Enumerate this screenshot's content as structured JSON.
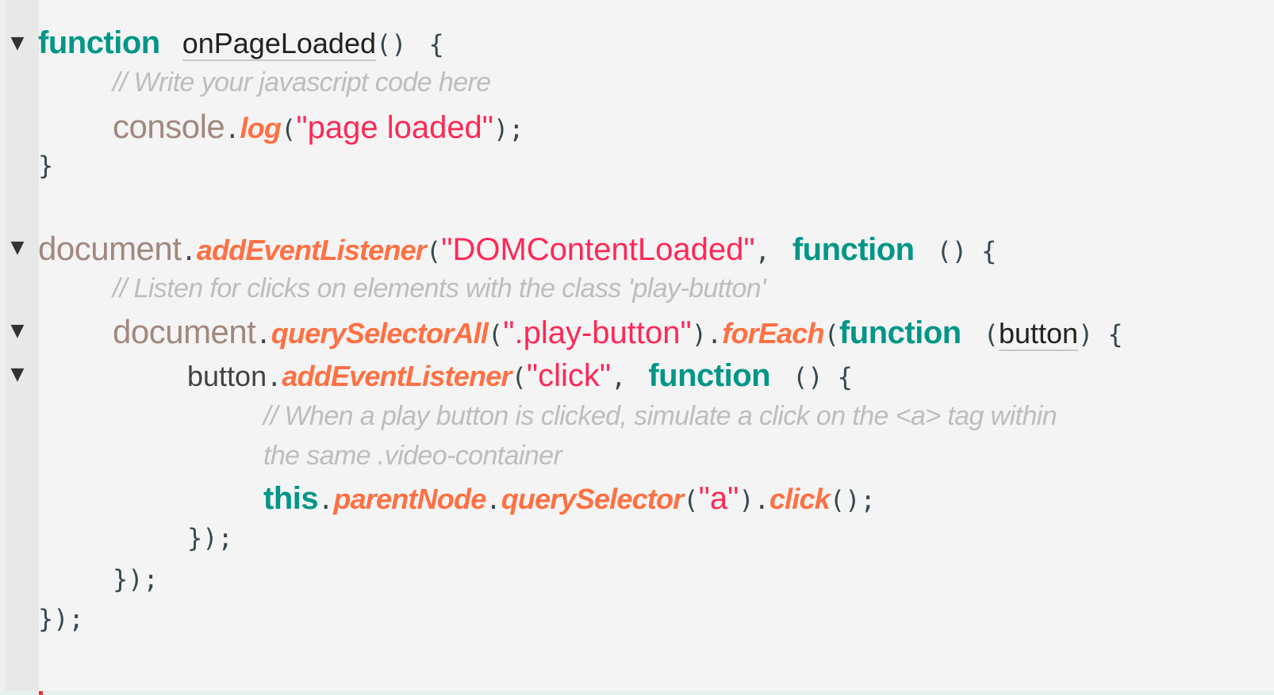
{
  "editor": {
    "accent_colors": {
      "keyword": "#009688",
      "object": "#a1887f",
      "method": "#ff7043",
      "string": "#ff2856",
      "comment": "#bdbdbd",
      "punctuation": "#37474f"
    },
    "fold_icon": "triangle-down",
    "lines": [
      {
        "kw": "function",
        "name": "onPageLoaded",
        "parens": "()",
        "brace": "{"
      },
      {
        "comment": "// Write your javascript code here"
      },
      {
        "obj": "console",
        "dot": ".",
        "method": "log",
        "open": "(",
        "str": "\"page loaded\"",
        "close": ");"
      },
      {
        "brace": "}"
      },
      {
        "obj": "document",
        "dot": ".",
        "method": "addEventListener",
        "open": "(",
        "str": "\"DOMContentLoaded\"",
        "comma": ",",
        "kw": "function",
        "parens": "()",
        "brace": "{"
      },
      {
        "comment": "// Listen for clicks on elements with the class 'play-button'"
      },
      {
        "obj": "document",
        "dot": ".",
        "method": "querySelectorAll",
        "open": "(",
        "str": "\".play-button\"",
        "close": ")",
        "dot2": ".",
        "method2": "forEach",
        "open2": "(",
        "kw": "function",
        "popen": "(",
        "param": "button",
        "pclose": ")",
        "brace": "{"
      },
      {
        "var": "button",
        "dot": ".",
        "method": "addEventListener",
        "open": "(",
        "str": "\"click\"",
        "comma": ",",
        "kw": "function",
        "parens": "()",
        "brace": "{"
      },
      {
        "comment": "// When a play button is clicked, simulate a click on the <a> tag within"
      },
      {
        "comment": "the same .video-container"
      },
      {
        "kw": "this",
        "dot": ".",
        "method": "parentNode",
        "dot2": ".",
        "method2": "querySelector",
        "open": "(",
        "str": "\"a\"",
        "close": ")",
        "dot3": ".",
        "method3": "click",
        "parens": "()",
        "semi": ";"
      },
      {
        "close": "});"
      },
      {
        "close": "});"
      },
      {
        "close": "});"
      }
    ]
  }
}
